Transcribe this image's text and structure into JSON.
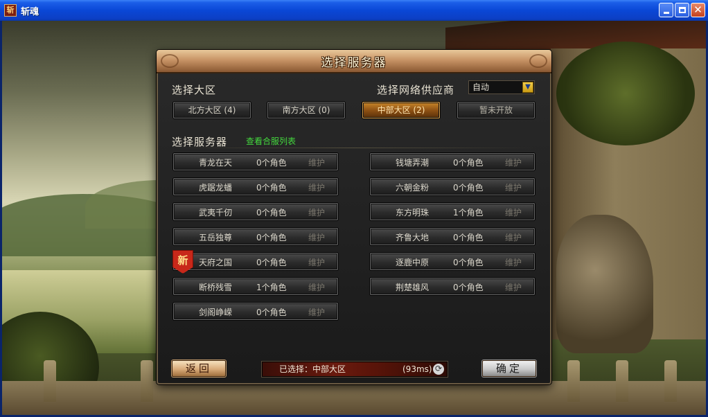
{
  "window": {
    "title": "斩魂"
  },
  "dialog": {
    "title": "选择服务器",
    "region_label": "选择大区",
    "isp_label": "选择网络供应商",
    "isp_value": "自动",
    "regions": [
      "北方大区 (4)",
      "南方大区 (0)",
      "中部大区 (2)",
      "暂未开放"
    ],
    "server_label": "选择服务器",
    "merged_list_link": "查看合服列表",
    "servers_left": [
      {
        "name": "青龙在天",
        "roles": "0个角色",
        "status": "维护"
      },
      {
        "name": "虎踞龙蟠",
        "roles": "0个角色",
        "status": "维护"
      },
      {
        "name": "武夷千仞",
        "roles": "0个角色",
        "status": "维护"
      },
      {
        "name": "五岳独尊",
        "roles": "0个角色",
        "status": "维护"
      },
      {
        "name": "天府之国",
        "roles": "0个角色",
        "status": "维护",
        "badge": "新"
      },
      {
        "name": "断桥残雪",
        "roles": "1个角色",
        "status": "维护"
      },
      {
        "name": "剑阁峥嵘",
        "roles": "0个角色",
        "status": "维护"
      }
    ],
    "servers_right": [
      {
        "name": "钱塘弄潮",
        "roles": "0个角色",
        "status": "维护"
      },
      {
        "name": "六朝金粉",
        "roles": "0个角色",
        "status": "维护"
      },
      {
        "name": "东方明珠",
        "roles": "1个角色",
        "status": "维护"
      },
      {
        "name": "齐鲁大地",
        "roles": "0个角色",
        "status": "维护"
      },
      {
        "name": "逐鹿中原",
        "roles": "0个角色",
        "status": "维护"
      },
      {
        "name": "荆楚雄风",
        "roles": "0个角色",
        "status": "维护"
      }
    ],
    "back_button": "返回",
    "confirm_button": "确定",
    "status": {
      "selected": "已选择：中部大区",
      "latency": "(93ms)"
    }
  }
}
